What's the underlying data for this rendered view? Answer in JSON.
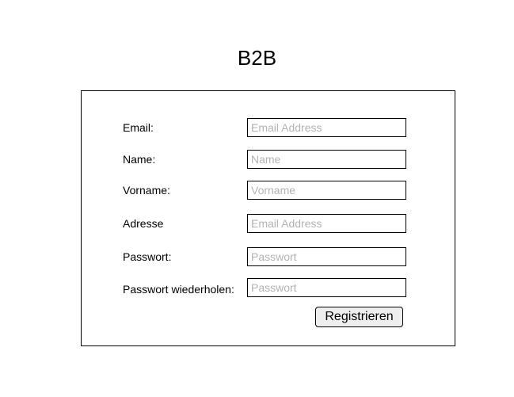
{
  "page": {
    "title": "B2B"
  },
  "form": {
    "fields": [
      {
        "label": "Email:",
        "value": "",
        "placeholder": "Email Address"
      },
      {
        "label": "Name:",
        "value": "",
        "placeholder": "Name"
      },
      {
        "label": "Vorname:",
        "value": "",
        "placeholder": "Vorname"
      },
      {
        "label": "Adresse",
        "value": "",
        "placeholder": "Email Address"
      },
      {
        "label": "Passwort:",
        "value": "",
        "placeholder": "Passwort"
      },
      {
        "label": "Passwort wiederholen:",
        "value": "",
        "placeholder": "Passwort"
      }
    ],
    "submit_label": "Registrieren"
  },
  "colors": {
    "placeholder": "#b3b3b3",
    "border": "#000000",
    "button_background": "#eeeeee"
  }
}
